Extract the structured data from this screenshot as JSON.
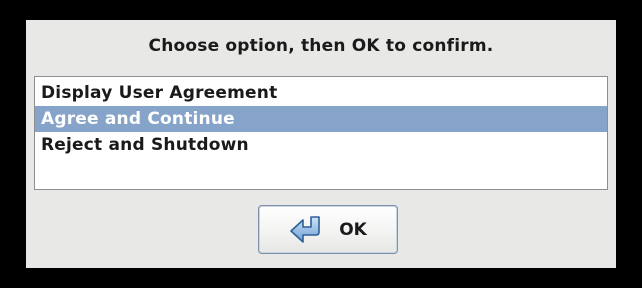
{
  "dialog": {
    "prompt": "Choose option, then OK to confirm.",
    "options": [
      {
        "label": "Display User Agreement",
        "selected": false
      },
      {
        "label": "Agree and Continue",
        "selected": true
      },
      {
        "label": "Reject and Shutdown",
        "selected": false
      }
    ],
    "ok_button": {
      "label": "OK",
      "icon": "return-arrow-icon"
    }
  },
  "colors": {
    "selection_bg": "#86a4c9",
    "selection_fg": "#ffffff",
    "dialog_bg": "#e8e8e7"
  }
}
